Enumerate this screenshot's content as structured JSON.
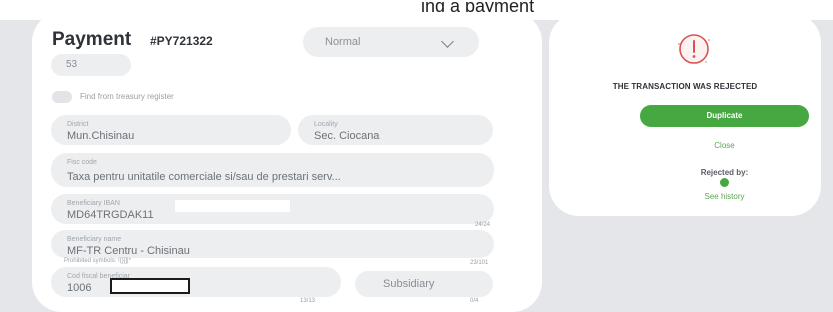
{
  "header": {
    "caption": "ing a payment"
  },
  "payment": {
    "title": "Payment",
    "id": "#PY721322",
    "type_select": "Normal",
    "small_field": "53",
    "treasury_checkbox_label": "Find from treasury register",
    "district": {
      "label": "District",
      "value": "Mun.Chisinau"
    },
    "locality": {
      "label": "Locality",
      "value": "Sec. Ciocana"
    },
    "fisc_code": {
      "label": "Fisc code",
      "value": "Taxa pentru unitatile comerciale si/sau de prestari serv..."
    },
    "iban": {
      "label": "Beneficiary IBAN",
      "value": "MD64TRGDAK11",
      "counter": "24/24"
    },
    "beneficiary_name": {
      "label": "Beneficiary name",
      "value": "MF-TR Centru - Chisinau",
      "counter": "23/101"
    },
    "prohibited_symbols": "Prohibited symbols: !{}[]|*",
    "fiscal_code": {
      "label": "Cod fiscal beneficiar",
      "value": "1006",
      "counter": "13/13"
    },
    "subsidiary": {
      "value": "Subsidiary",
      "counter": "0/4"
    }
  },
  "status": {
    "title": "THE TRANSACTION WAS REJECTED",
    "duplicate_label": "Duplicate",
    "close_label": "Close",
    "rejected_by_label": "Rejected by:",
    "see_history_label": "See history",
    "accent_color": "#46a840",
    "alert_color": "#d9534f"
  }
}
